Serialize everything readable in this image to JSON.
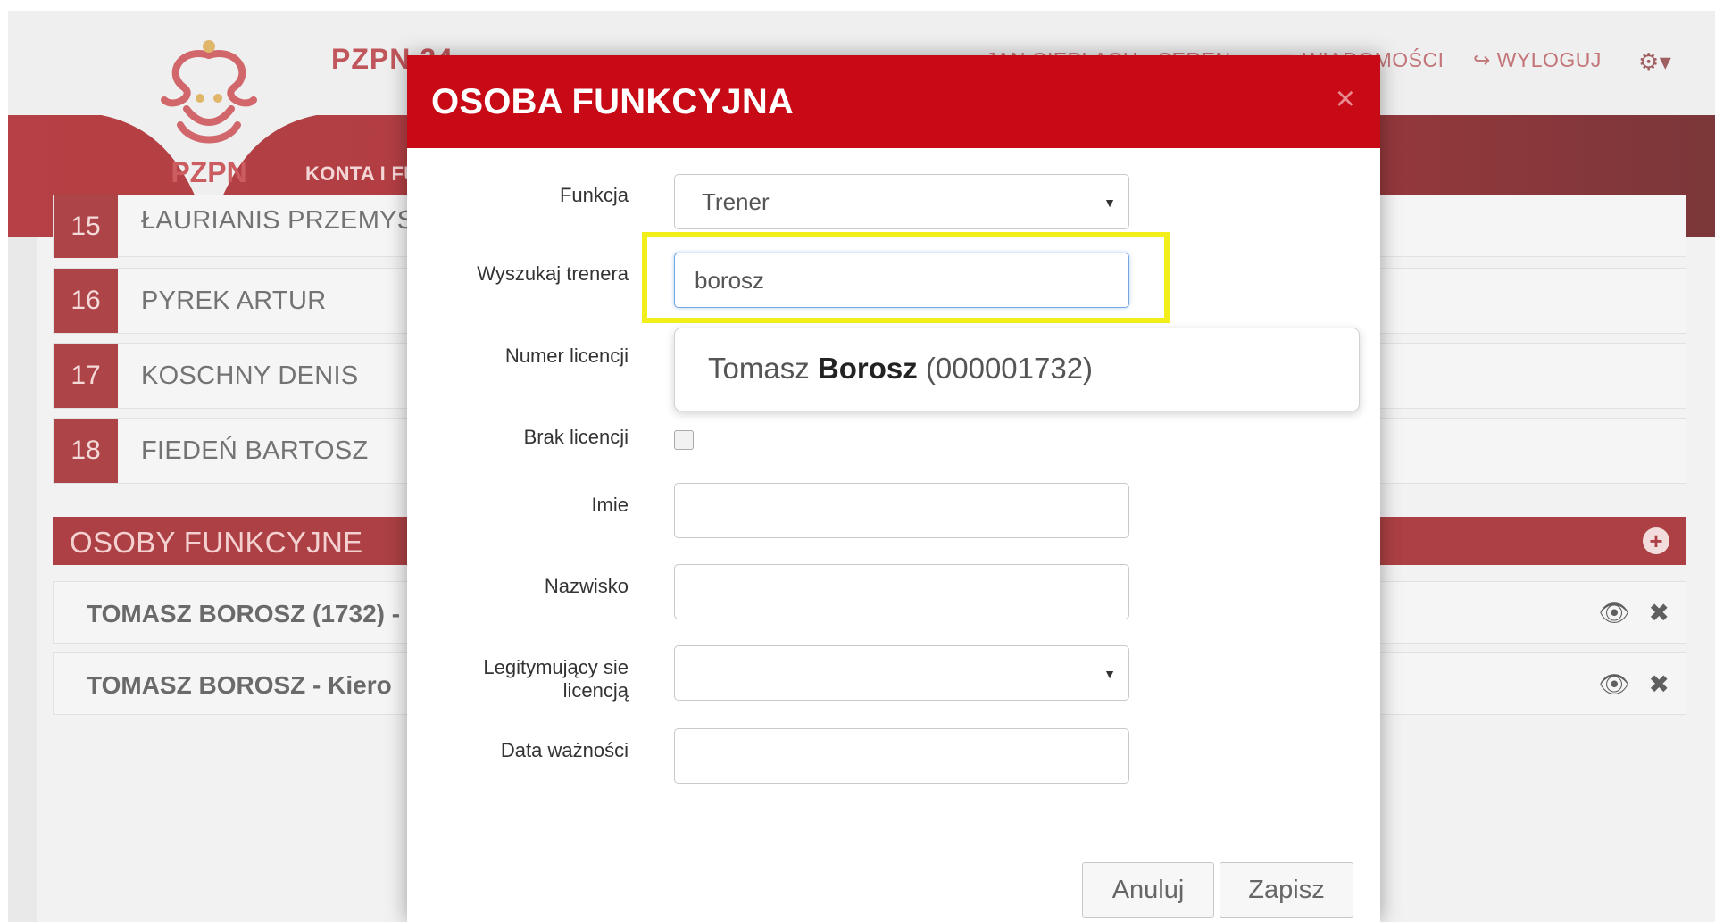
{
  "header": {
    "brand": "PZPN 24",
    "user_link": "JAN CIEPLACH - SEREN",
    "messages_label": "WIADOMOŚCI",
    "logout_label": "WYLOGUJ",
    "nav_label": "KONTA I FU",
    "logo_text": "PZPN"
  },
  "players": [
    {
      "number": "15",
      "name": "ŁAURIANIS PRZEMYSŁ"
    },
    {
      "number": "16",
      "name": "PYREK ARTUR"
    },
    {
      "number": "17",
      "name": "KOSCHNY DENIS"
    },
    {
      "number": "18",
      "name": "FIEDEŃ BARTOSZ"
    }
  ],
  "staff_section": {
    "title": "OSOBY FUNKCYJNE",
    "add_icon": "plus-circle-icon",
    "rows": [
      {
        "name": "TOMASZ BOROSZ (1732) -"
      },
      {
        "name": "TOMASZ BOROSZ - Kiero"
      }
    ]
  },
  "modal": {
    "title": "OSOBA FUNKCYJNA",
    "close": "×",
    "fields": {
      "funkcja_label": "Funkcja",
      "funkcja_value": "Trener",
      "search_label": "Wyszukaj trenera",
      "search_value": "borosz",
      "licence_label": "Numer licencji",
      "no_licence_label": "Brak licencji",
      "first_name_label": "Imie",
      "last_name_label": "Nazwisko",
      "licence_holder_label_1": "Legitymujący sie",
      "licence_holder_label_2": "licencją",
      "expiry_label": "Data ważności"
    },
    "autocomplete": {
      "first": "Tomasz",
      "match": "Borosz",
      "licence": "(000001732)"
    },
    "buttons": {
      "cancel": "Anuluj",
      "save": "Zapisz"
    }
  },
  "colors": {
    "brand_red": "#c70a15",
    "highlight": "#f2ee1a",
    "focus_blue": "#77a7e0"
  }
}
